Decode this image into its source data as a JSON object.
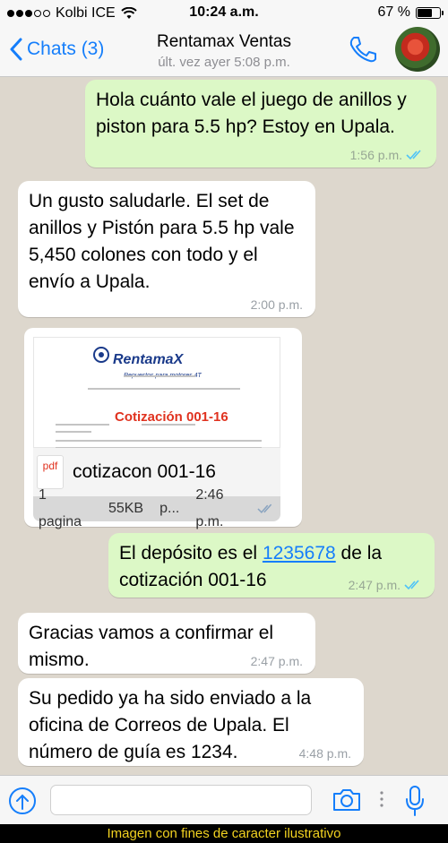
{
  "status_bar": {
    "carrier": "Kolbi ICE",
    "time": "10:24 a.m.",
    "battery": "67 %",
    "battery_level": 0.67
  },
  "header": {
    "back_label": "Chats (3)",
    "contact_name": "Rentamax Ventas",
    "last_seen": "últ. vez ayer 5:08 p.m."
  },
  "messages": [
    {
      "direction": "out",
      "text": "Hola cuánto vale el juego de anillos y piston para 5.5 hp? Estoy en Upala.",
      "time": "1:56 p.m.",
      "read": true
    },
    {
      "direction": "in",
      "text": "Un gusto saludarle. El set de anillos y Pistón para 5.5 hp vale 5,450 colones con todo y el envío a Upala.",
      "time": "2:00 p.m."
    },
    {
      "direction": "in",
      "type": "document",
      "doc": {
        "logo": "RentamaX",
        "logo_sub": "Repuestos para motores 4T",
        "preview_title": "Cotización 001-16",
        "file_icon": "pdf",
        "file_name": "cotizacon 001-16",
        "pages": "1 pagina",
        "size": "55KB",
        "type": "p..."
      },
      "time": "2:46 p.m."
    },
    {
      "direction": "out",
      "text_before": "El depósito es el ",
      "link": "1235678",
      "text_after": " de la cotización 001-16",
      "time": "2:47 p.m.",
      "read": true
    },
    {
      "direction": "in",
      "text": "Gracias vamos a confirmar el mismo.",
      "time": "2:47 p.m."
    },
    {
      "direction": "in",
      "text": "Su pedido ya ha sido enviado a la oficina de Correos de Upala. El número de guía es 1234.",
      "time": "4:48 p.m."
    }
  ],
  "footer_note": "Imagen con fines de caracter ilustrativo",
  "colors": {
    "accent": "#157efb",
    "outgoing_bubble": "#dcf8c6",
    "incoming_bubble": "#ffffff",
    "chat_background": "#ddd7cd",
    "footer_text": "#f3d321"
  }
}
